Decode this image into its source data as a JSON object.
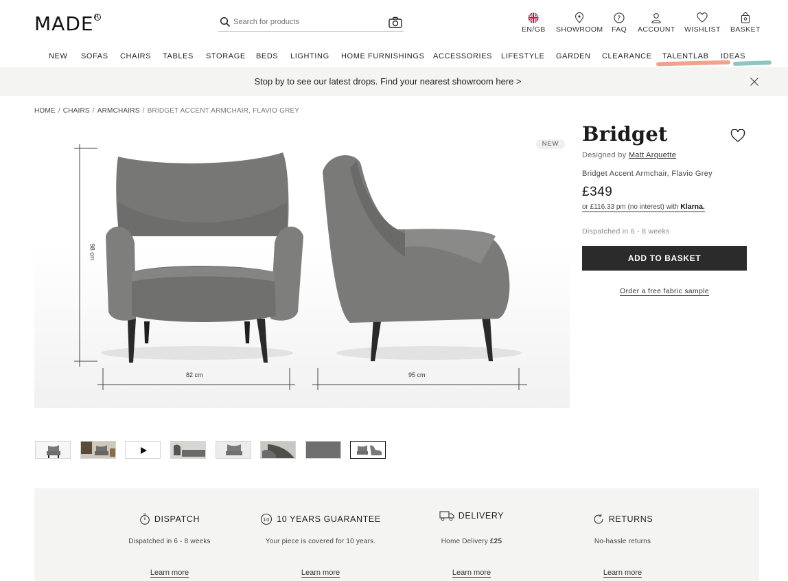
{
  "header": {
    "logo": "MADE",
    "logo_mark": "R",
    "search_placeholder": "Search for products",
    "utility": [
      {
        "label": "EN/GB",
        "icon": "uk-flag-icon"
      },
      {
        "label": "SHOWROOM",
        "icon": "location-pin-icon"
      },
      {
        "label": "FAQ",
        "icon": "question-icon"
      },
      {
        "label": "ACCOUNT",
        "icon": "user-icon"
      },
      {
        "label": "WISHLIST",
        "icon": "heart-icon"
      },
      {
        "label": "BASKET",
        "icon": "bag-icon"
      }
    ]
  },
  "nav": {
    "items": [
      "NEW",
      "SOFAS",
      "CHAIRS",
      "TABLES",
      "STORAGE",
      "BEDS",
      "LIGHTING",
      "HOME FURNISHINGS",
      "ACCESSORIES",
      "LIFESTYLE",
      "GARDEN",
      "CLEARANCE",
      "TALENTLAB",
      "IDEAS"
    ],
    "accent_colors": {
      "talentlab": "#f0a28e",
      "ideas": "#8fc3c4"
    }
  },
  "banner": {
    "message": "Stop by to see our latest drops. Find your nearest showroom here >"
  },
  "breadcrumb": [
    "HOME",
    "CHAIRS",
    "ARMCHAIRS",
    "BRIDGET ACCENT ARMCHAIR, FLAVIO GREY"
  ],
  "gallery": {
    "badge": "NEW",
    "dimensions": {
      "height": "98 cm",
      "width": "82 cm",
      "depth": "95 cm"
    },
    "thumbnail_count": 8,
    "selected_thumbnail": 8
  },
  "product": {
    "title": "Bridget",
    "designed_by_prefix": "Designed by",
    "designer": "Matt Arquette",
    "full_name": "Bridget Accent Armchair, Flavio Grey",
    "price": "£349",
    "klarna_text": "or £116.33 pm (no interest) with",
    "klarna_brand": "Klarna.",
    "dispatch": "Dispatched in 6 - 8 weeks",
    "add_to_basket": "ADD TO BASKET",
    "fabric_sample": "Order a free fabric sample"
  },
  "features": [
    {
      "title": "DISPATCH",
      "desc": "Dispatched in 6 - 8 weeks",
      "link": "Learn more",
      "icon": "stopwatch-icon"
    },
    {
      "title": "10 YEARS GUARANTEE",
      "desc": "Your piece is covered for 10 years.",
      "link": "Learn more",
      "icon": "ten-badge-icon"
    },
    {
      "title": "DELIVERY",
      "desc_prefix": "Home Delivery",
      "desc_value": "£25",
      "link": "Learn more",
      "icon": "truck-icon"
    },
    {
      "title": "RETURNS",
      "desc": "No-hassle returns",
      "link": "Learn more",
      "icon": "refresh-icon"
    }
  ]
}
